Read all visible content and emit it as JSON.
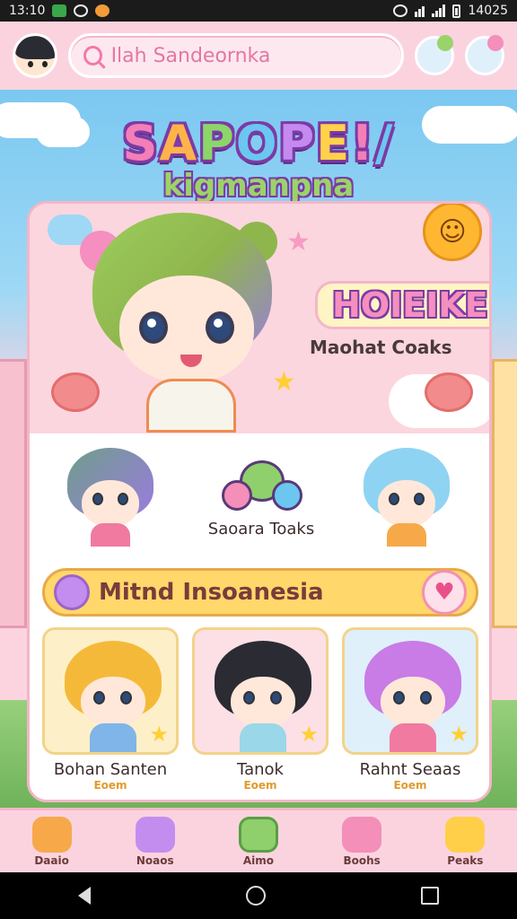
{
  "status_bar": {
    "time_left": "13:10",
    "time_right": "14025"
  },
  "header": {
    "search_placeholder": "Ilah Sandeornka"
  },
  "hero": {
    "title_letters": [
      "S",
      "A",
      "P",
      "O",
      "P",
      "E",
      "!",
      "/"
    ],
    "title_text": "SaPOPE!/",
    "subtitle": "kigmanpna",
    "badge": "HOIEIKE",
    "caption": "Maohat Coaks"
  },
  "featured": {
    "label": "Saoara Toaks"
  },
  "section": {
    "title": "Mitnd Insoanesia"
  },
  "tiles": [
    {
      "name": "Bohan Santen",
      "sub": "Eoem",
      "bg": "#fdf0c8",
      "hair": "#f5b93a",
      "body": "#7fb5e8"
    },
    {
      "name": "Tanok",
      "sub": "Eoem",
      "bg": "#fde0e6",
      "hair": "#2b2b33",
      "body": "#9ad7e8"
    },
    {
      "name": "Rahnt Seaas",
      "sub": "Eoem",
      "bg": "#dff0fb",
      "hair": "#c97be6",
      "body": "#f07aa0"
    }
  ],
  "bottom_nav": [
    {
      "label": "Daaio",
      "icon": "house-icon",
      "color": "#f7a94a"
    },
    {
      "label": "Noaos",
      "icon": "candy-icon",
      "color": "#c38df0"
    },
    {
      "label": "Aimo",
      "icon": "chest-icon",
      "color": "#8fd06c"
    },
    {
      "label": "Boohs",
      "icon": "bubble-icon",
      "color": "#f38fb8"
    },
    {
      "label": "Peaks",
      "icon": "character-icon",
      "color": "#ffcf4a"
    }
  ],
  "colors": {
    "accent_pink": "#f27aa8",
    "banner_yellow": "#ffd76a",
    "outline_purple": "#7c3aa5"
  }
}
